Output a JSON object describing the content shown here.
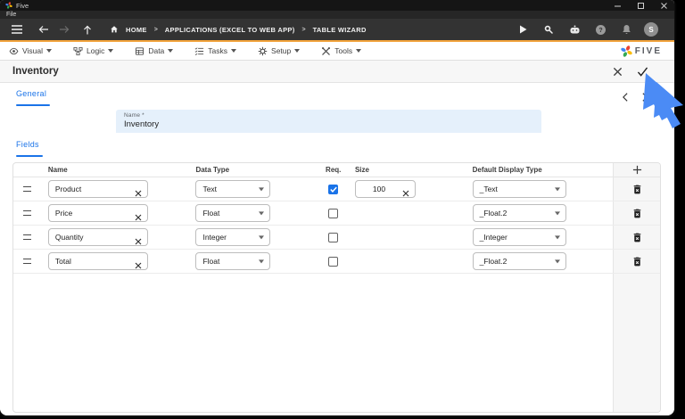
{
  "window": {
    "app_title": "Five",
    "file_menu": "File"
  },
  "toolbar": {
    "breadcrumb": {
      "home": "HOME",
      "separator": ">",
      "app": "APPLICATIONS (EXCEL TO WEB APP)",
      "page": "TABLE WIZARD"
    },
    "avatar_initial": "S"
  },
  "appmenu": {
    "items": [
      "Visual",
      "Logic",
      "Data",
      "Tasks",
      "Setup",
      "Tools"
    ],
    "brand": "FIVE"
  },
  "page": {
    "title": "Inventory"
  },
  "form": {
    "general_tab": "General",
    "fields_tab": "Fields",
    "name_label": "Name *",
    "name_value": "Inventory"
  },
  "fields_table": {
    "headers": {
      "name": "Name",
      "data_type": "Data Type",
      "req": "Req.",
      "size": "Size",
      "default_display_type": "Default Display Type"
    },
    "rows": [
      {
        "name": "Product",
        "data_type": "Text",
        "req": true,
        "size": "100",
        "default_display_type": "_Text"
      },
      {
        "name": "Price",
        "data_type": "Float",
        "req": false,
        "size": "",
        "default_display_type": "_Float.2"
      },
      {
        "name": "Quantity",
        "data_type": "Integer",
        "req": false,
        "size": "",
        "default_display_type": "_Integer"
      },
      {
        "name": "Total",
        "data_type": "Float",
        "req": false,
        "size": "",
        "default_display_type": "_Float.2"
      }
    ]
  },
  "colors": {
    "accent_yellow": "#F2A33C",
    "tab_blue": "#1A73E8",
    "checkbox_blue": "#1A73E8",
    "cursor_blue": "#4B8BF5",
    "name_field_bg": "#E5F0FB"
  }
}
